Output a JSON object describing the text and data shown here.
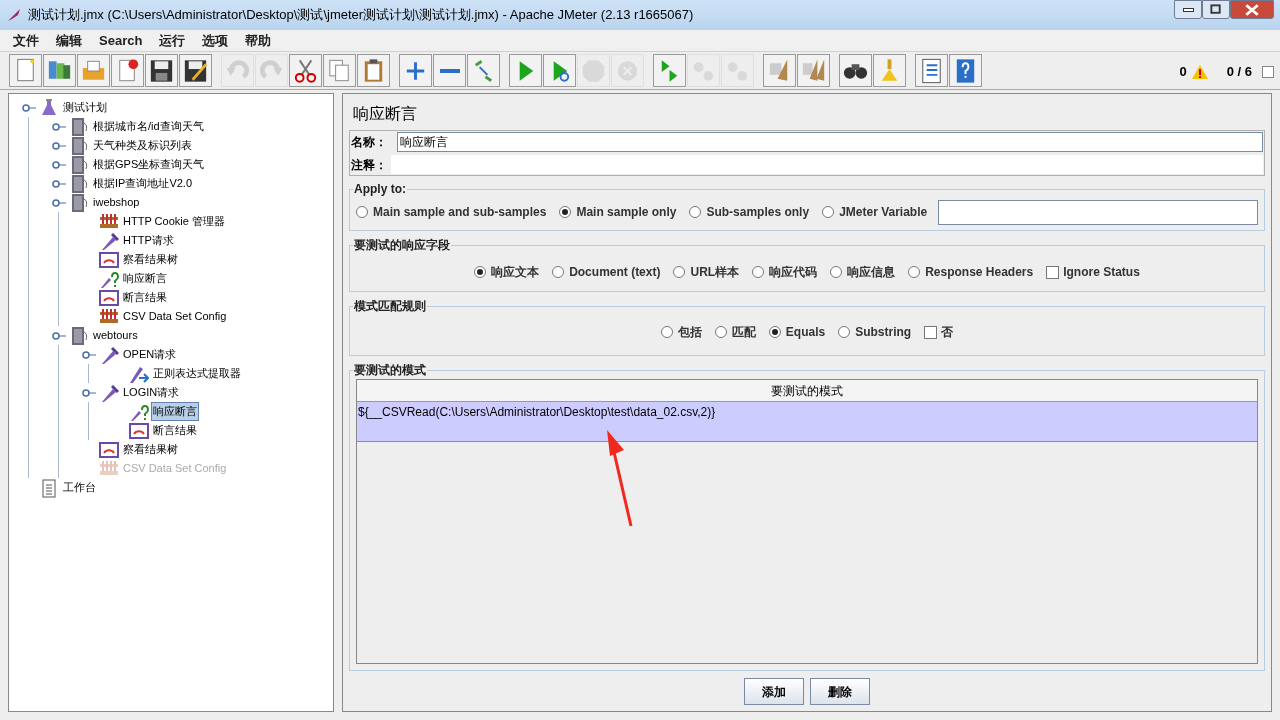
{
  "window": {
    "title": "测试计划.jmx (C:\\Users\\Administrator\\Desktop\\测试\\jmeter测试计划\\测试计划.jmx) - Apache JMeter (2.13 r1665067)"
  },
  "menu": [
    "文件",
    "编辑",
    "Search",
    "运行",
    "选项",
    "帮助"
  ],
  "toolbar": [
    {
      "kind": "new",
      "disabled": false
    },
    {
      "kind": "templates",
      "disabled": false
    },
    {
      "kind": "open",
      "disabled": false
    },
    {
      "kind": "close",
      "disabled": false
    },
    {
      "kind": "save",
      "disabled": false
    },
    {
      "kind": "saveas",
      "disabled": false
    },
    {
      "kind": "sep"
    },
    {
      "kind": "undo",
      "disabled": true
    },
    {
      "kind": "redo",
      "disabled": true
    },
    {
      "kind": "cut",
      "disabled": false
    },
    {
      "kind": "copy",
      "disabled": false
    },
    {
      "kind": "paste",
      "disabled": false
    },
    {
      "kind": "sep"
    },
    {
      "kind": "expand",
      "disabled": false
    },
    {
      "kind": "collapse",
      "disabled": false
    },
    {
      "kind": "toggle",
      "disabled": false
    },
    {
      "kind": "sep"
    },
    {
      "kind": "start",
      "disabled": false
    },
    {
      "kind": "startnp",
      "disabled": false
    },
    {
      "kind": "stop",
      "disabled": true
    },
    {
      "kind": "shutdown",
      "disabled": true
    },
    {
      "kind": "sep"
    },
    {
      "kind": "remotestart",
      "disabled": false
    },
    {
      "kind": "remotestop",
      "disabled": true
    },
    {
      "kind": "remoteshut",
      "disabled": true
    },
    {
      "kind": "sep"
    },
    {
      "kind": "clear",
      "disabled": false
    },
    {
      "kind": "clearall",
      "disabled": false
    },
    {
      "kind": "sep"
    },
    {
      "kind": "search",
      "disabled": false
    },
    {
      "kind": "reset",
      "disabled": false
    },
    {
      "kind": "sep"
    },
    {
      "kind": "functions",
      "disabled": false
    },
    {
      "kind": "help",
      "disabled": false
    }
  ],
  "status": {
    "errors": "0",
    "threads": "0 / 6"
  },
  "tree": [
    {
      "label": "测试计划",
      "kind": "plan",
      "handle": true,
      "selected": false,
      "disabled": false,
      "children": [
        {
          "label": "根据城市名/id查询天气",
          "kind": "thread",
          "handle": true,
          "selected": false,
          "disabled": false
        },
        {
          "label": "天气种类及标识列表",
          "kind": "thread",
          "handle": true,
          "selected": false,
          "disabled": false
        },
        {
          "label": "根据GPS坐标查询天气",
          "kind": "thread",
          "handle": true,
          "selected": false,
          "disabled": false
        },
        {
          "label": "根据IP查询地址V2.0",
          "kind": "thread",
          "handle": true,
          "selected": false,
          "disabled": false
        },
        {
          "label": "iwebshop",
          "kind": "thread",
          "handle": true,
          "selected": false,
          "disabled": false,
          "children": [
            {
              "label": "HTTP Cookie 管理器",
              "kind": "config",
              "handle": false,
              "selected": false,
              "disabled": false
            },
            {
              "label": "HTTP请求",
              "kind": "sampler",
              "handle": false,
              "selected": false,
              "disabled": false
            },
            {
              "label": "察看结果树",
              "kind": "listener",
              "handle": false,
              "selected": false,
              "disabled": false
            },
            {
              "label": "响应断言",
              "kind": "assertion",
              "handle": false,
              "selected": false,
              "disabled": false
            },
            {
              "label": "断言结果",
              "kind": "listener",
              "handle": false,
              "selected": false,
              "disabled": false
            },
            {
              "label": "CSV Data Set Config",
              "kind": "config",
              "handle": false,
              "selected": false,
              "disabled": false
            }
          ]
        },
        {
          "label": "webtours",
          "kind": "thread",
          "handle": true,
          "selected": false,
          "disabled": false,
          "children": [
            {
              "label": "OPEN请求",
              "kind": "sampler",
              "handle": true,
              "selected": false,
              "disabled": false,
              "children": [
                {
                  "label": "正则表达式提取器",
                  "kind": "extractor",
                  "handle": false,
                  "selected": false,
                  "disabled": false
                }
              ]
            },
            {
              "label": "LOGIN请求",
              "kind": "sampler",
              "handle": true,
              "selected": false,
              "disabled": false,
              "children": [
                {
                  "label": "响应断言",
                  "kind": "assertion",
                  "handle": false,
                  "selected": true,
                  "disabled": false
                },
                {
                  "label": "断言结果",
                  "kind": "listener",
                  "handle": false,
                  "selected": false,
                  "disabled": false
                }
              ]
            },
            {
              "label": "察看结果树",
              "kind": "listener",
              "handle": false,
              "selected": false,
              "disabled": false
            },
            {
              "label": "CSV Data Set Config",
              "kind": "config",
              "handle": false,
              "selected": false,
              "disabled": true
            }
          ]
        }
      ]
    },
    {
      "label": "工作台",
      "kind": "workbench",
      "handle": false,
      "selected": false,
      "disabled": false
    }
  ],
  "panel": {
    "title": "响应断言",
    "name_label": "名称：",
    "name_value": "响应断言",
    "comment_label": "注释：",
    "apply_to": {
      "legend": "Apply to:",
      "options": [
        {
          "label": "Main sample and sub-samples",
          "selected": false
        },
        {
          "label": "Main sample only",
          "selected": true
        },
        {
          "label": "Sub-samples only",
          "selected": false
        },
        {
          "label": "JMeter Variable",
          "selected": false
        }
      ]
    },
    "response_field": {
      "legend": "要测试的响应字段",
      "options": [
        {
          "label": "响应文本",
          "selected": true
        },
        {
          "label": "Document (text)",
          "selected": false
        },
        {
          "label": "URL样本",
          "selected": false
        },
        {
          "label": "响应代码",
          "selected": false
        },
        {
          "label": "响应信息",
          "selected": false
        },
        {
          "label": "Response Headers",
          "selected": false
        }
      ],
      "checkbox": {
        "label": "Ignore Status",
        "checked": false
      }
    },
    "pattern_rule": {
      "legend": "模式匹配规则",
      "options": [
        {
          "label": "包括",
          "selected": false
        },
        {
          "label": "匹配",
          "selected": false
        },
        {
          "label": "Equals",
          "selected": true
        },
        {
          "label": "Substring",
          "selected": false
        }
      ],
      "checkbox": {
        "label": "否",
        "checked": false
      }
    },
    "patterns": {
      "legend": "要测试的模式",
      "column": "要测试的模式",
      "rows": [
        {
          "text": "${__CSVRead(C:\\Users\\Administrator\\Desktop\\test\\data_02.csv,2)}",
          "selected": true
        }
      ]
    },
    "buttons": [
      "添加",
      "删除"
    ]
  }
}
